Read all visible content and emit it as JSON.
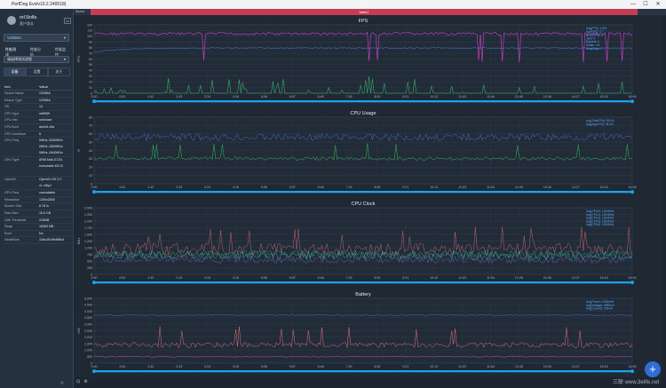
{
  "app": {
    "title": "PerfDog Evolv10.2.240518)",
    "controls": [
      "—",
      "☐",
      "✕"
    ]
  },
  "sidebar": {
    "user_name": "ref.5iolfa",
    "user_role": "客户版本",
    "device": "V2056A",
    "tabs": [
      "性能测试",
      "性能分析",
      "性能监控"
    ],
    "app_select": "请选择测试进程",
    "subtabs": [
      "设备",
      "设置",
      "关于"
    ],
    "info_headers": {
      "key": "Info",
      "value": "Value"
    },
    "info_rows": [
      {
        "k": "Device Name",
        "v": "V2056A"
      },
      {
        "k": "Device Type",
        "v": "V2056A"
      },
      {
        "k": "OS",
        "v": "14"
      },
      {
        "k": "CPU Type",
        "v": "mt6989"
      },
      {
        "k": "CPU Info",
        "v": "unknown"
      },
      {
        "k": "CPU Arch",
        "v": "arm64-v8a"
      },
      {
        "k": "CPU CoreNum",
        "v": "8"
      },
      {
        "k": "CPU Freq",
        "v": "0MHz–2000MHz 0MHz–2600MHz 0MHz–3400MHz"
      },
      {
        "k": "GPU Type",
        "v": "ARM Mali-G720-Immortalis MC12"
      },
      {
        "k": "OpenGL",
        "v": "OpenGL ES 3.2 v1.r46p1"
      },
      {
        "k": "GPU Freq",
        "v": "unavailable"
      },
      {
        "k": "Resolution",
        "v": "1260x2800"
      },
      {
        "k": "Screen Size",
        "v": "6.78 in"
      },
      {
        "k": "Ram Size",
        "v": "15.0 GB"
      },
      {
        "k": "LMK Threshold",
        "v": "216MB"
      },
      {
        "k": "Swap",
        "v": "16383 MB"
      },
      {
        "k": "Root",
        "v": "No"
      },
      {
        "k": "SerialNum",
        "v": "10dc4f1bf9d6Bc6"
      }
    ]
  },
  "topbar": {
    "toolbar_label": "Scene Tips",
    "label": "label1"
  },
  "time_ticks": [
    "0:00",
    "0:51",
    "1:42",
    "2:33",
    "3:24",
    "4:15",
    "5:06",
    "5:57",
    "6:48",
    "7:39",
    "8:30",
    "9:21",
    "10:12",
    "11:03",
    "11:54",
    "12:45",
    "13:36",
    "14:27",
    "15:18",
    "16:09"
  ],
  "charts": [
    {
      "title": "FPS",
      "ylabel": "FPS",
      "yticks": [
        "0",
        "10",
        "20",
        "30",
        "40",
        "50",
        "60",
        "70",
        "80",
        "90",
        "100",
        "110",
        "120"
      ],
      "legend": [
        "Avg(FPS): 119.9",
        "Var(FPS): 0.7",
        "Drop(FPS): 0",
        "Jank: 0",
        "BigJank: 0",
        "Stutter: 0%",
        "SmallJank: 0"
      ],
      "colors": {
        "fps": "#d63fd6",
        "jank": "#38c172",
        "ftime": "#4a7fe0",
        "jankline": "#e65f4d"
      }
    },
    {
      "title": "CPU Usage",
      "ylabel": "%",
      "yticks": [
        "0",
        "10",
        "20",
        "30",
        "40",
        "50",
        "60",
        "70",
        "80"
      ],
      "legend": [
        "Avg(TotalCPU): 55.2%",
        "Avg(AppCPU): 28.4%"
      ],
      "colors": {
        "total": "#4a6fd6",
        "app": "#38b85e"
      }
    },
    {
      "title": "CPU Clock",
      "ylabel": "MHz",
      "yticks": [
        "0",
        "250",
        "500",
        "750",
        "1,000",
        "1,250",
        "1,500",
        "1,750",
        "2,000",
        "2,250",
        "2,500"
      ],
      "legend": [
        "Avg(CPU0): 1200MHz",
        "Avg(CPU1): 1200MHz",
        "Avg(CPU2): 1300MHz",
        "Avg(CPU3): 1300MHz",
        "Avg(CPU4): 1300MHz"
      ],
      "colors": {
        "c0": "#e3707a",
        "c1": "#3fb8d8",
        "c2": "#8a62c8",
        "c3": "#40b87a",
        "c4": "#d6a83a"
      }
    },
    {
      "title": "Battery",
      "ylabel": "mW",
      "yticks": [
        "0",
        "500",
        "1,000",
        "1,500",
        "2,000",
        "2,500",
        "3,000",
        "3,500",
        "4,000",
        "4,500",
        "5,000"
      ],
      "legend": [
        "Avg(Power): 2080mW",
        "Avg(Voltage): 3950mV",
        "Avg(Current): 530mA"
      ],
      "colors": {
        "power": "#e3707a",
        "voltage": "#4a6fd6",
        "current": "#c848c8"
      }
    }
  ],
  "bottom": {
    "icons": [
      "⊡",
      "⚙"
    ],
    "fab": "+",
    "watermark": "三联 www.3elife.net"
  }
}
